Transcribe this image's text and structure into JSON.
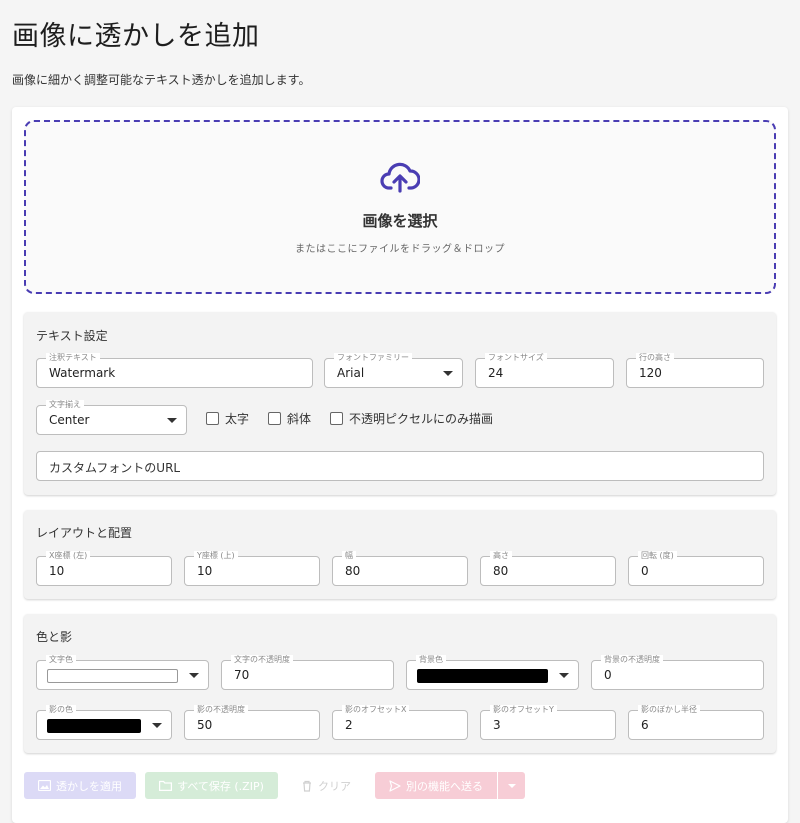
{
  "page": {
    "title": "画像に透かしを追加",
    "description": "画像に細かく調整可能なテキスト透かしを追加します。"
  },
  "dropzone": {
    "title": "画像を選択",
    "subtitle": "またはここにファイルをドラッグ＆ドロップ",
    "icon": "cloud-upload-icon"
  },
  "text_settings": {
    "title": "テキスト設定",
    "watermark_text": {
      "label": "注釈テキスト",
      "value": "Watermark"
    },
    "font_family": {
      "label": "フォントファミリー",
      "value": "Arial"
    },
    "font_size": {
      "label": "フォントサイズ",
      "value": "24"
    },
    "line_height": {
      "label": "行の高さ",
      "value": "120"
    },
    "text_align": {
      "label": "文字揃え",
      "value": "Center"
    },
    "bold_label": "太字",
    "italic_label": "斜体",
    "opaque_only_label": "不透明ピクセルにのみ描画",
    "custom_font": {
      "placeholder": "カスタムフォントのURL"
    }
  },
  "layout": {
    "title": "レイアウトと配置",
    "x": {
      "label": "X座標 (左)",
      "value": "10"
    },
    "y": {
      "label": "Y座標 (上)",
      "value": "10"
    },
    "width": {
      "label": "幅",
      "value": "80"
    },
    "height": {
      "label": "高さ",
      "value": "80"
    },
    "rotation": {
      "label": "回転 (度)",
      "value": "0"
    }
  },
  "colors": {
    "title": "色と影",
    "text_color": {
      "label": "文字色",
      "value": "#ffffff"
    },
    "text_opacity": {
      "label": "文字の不透明度",
      "value": "70"
    },
    "background_color": {
      "label": "背景色",
      "value": "#000000"
    },
    "background_opacity": {
      "label": "背景の不透明度",
      "value": "0"
    },
    "shadow_color": {
      "label": "影の色",
      "value": "#000000"
    },
    "shadow_opacity": {
      "label": "影の不透明度",
      "value": "50"
    },
    "shadow_offset_x": {
      "label": "影のオフセットX",
      "value": "2"
    },
    "shadow_offset_y": {
      "label": "影のオフセットY",
      "value": "3"
    },
    "shadow_blur": {
      "label": "影のぼかし半径",
      "value": "6"
    }
  },
  "actions": {
    "apply": "透かしを適用",
    "save_all": "すべて保存 (.ZIP)",
    "clear": "クリア",
    "send": "別の機能へ送る"
  },
  "theme": {
    "accent": "#4a3db3",
    "apply_bg": "#dcdaf6",
    "save_bg": "#d5ecd8",
    "send_bg": "#f7cdd6"
  }
}
